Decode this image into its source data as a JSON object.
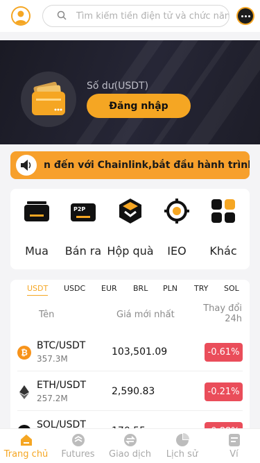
{
  "header": {
    "search_placeholder": "Tìm kiếm tiền điện tử và chức năng",
    "avatar_icon": "user-avatar-icon",
    "support_icon": "chat-support-icon"
  },
  "banner": {
    "balance_label": "Số dư(USDT)",
    "login_button": "Đăng nhập"
  },
  "notice": {
    "text": "n đến với Chainlink,bắt đầu hành trình mới"
  },
  "quick_menu": [
    {
      "label": "Mua",
      "icon": "buy-card-icon"
    },
    {
      "label": "Bán ra",
      "icon": "p2p-icon"
    },
    {
      "label": "Hộp quà",
      "icon": "gift-box-icon"
    },
    {
      "label": "IEO",
      "icon": "ieo-target-icon"
    },
    {
      "label": "Khác",
      "icon": "grid-more-icon"
    }
  ],
  "market": {
    "tabs": [
      "USDT",
      "USDC",
      "EUR",
      "BRL",
      "PLN",
      "TRY",
      "SOL"
    ],
    "active_tab": "USDT",
    "columns": {
      "name": "Tên",
      "price": "Giá mới nhất",
      "change_line1": "Thay đổi",
      "change_line2": "24h"
    },
    "rows": [
      {
        "pair": "BTC/USDT",
        "volume": "357.3M",
        "price": "103,501.09",
        "change": "-0.61%",
        "coin": "btc-icon"
      },
      {
        "pair": "ETH/USDT",
        "volume": "257.2M",
        "price": "2,590.83",
        "change": "-0.21%",
        "coin": "eth-icon"
      },
      {
        "pair": "SOL/USDT",
        "volume": "",
        "price": "170.55",
        "change": "-0.88%",
        "coin": "sol-icon"
      }
    ]
  },
  "bottom_nav": [
    {
      "label": "Trang chủ",
      "active": true
    },
    {
      "label": "Futures",
      "active": false
    },
    {
      "label": "Giao dịch",
      "active": false
    },
    {
      "label": "Lịch sử",
      "active": false
    },
    {
      "label": "Ví",
      "active": false
    }
  ],
  "colors": {
    "accent": "#f5a623",
    "negative": "#ea4d5a",
    "banner_bg": "#1f1f2b"
  }
}
